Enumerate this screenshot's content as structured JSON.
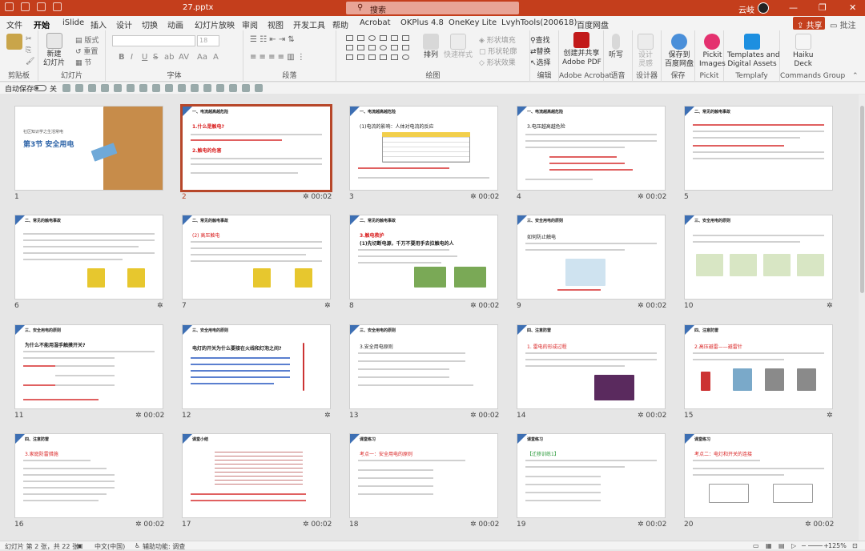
{
  "window": {
    "filename": "27.pptx",
    "search_placeholder": "搜索",
    "user": "云岐",
    "controls": [
      "—",
      "❐",
      "✕"
    ]
  },
  "tabs": [
    "文件",
    "开始",
    "iSlide",
    "插入",
    "设计",
    "切换",
    "动画",
    "幻灯片放映",
    "审阅",
    "视图",
    "开发工具",
    "帮助",
    "Acrobat",
    "OKPlus 4.8",
    "OneKey Lite",
    "LvyhTools(200618)",
    "百度网盘"
  ],
  "active_tab": "开始",
  "share_label": "共享",
  "comment_label": "批注",
  "ribbon": {
    "clipboard": {
      "label": "剪贴板"
    },
    "slides": {
      "label": "幻灯片",
      "new_slide": "新建\n幻灯片",
      "layout": "版式",
      "reset": "重置",
      "section": "节"
    },
    "font": {
      "label": "字体",
      "size": "18",
      "format_buttons": [
        "B",
        "I",
        "U",
        "S",
        "ab",
        "AV",
        "Aa",
        "A"
      ]
    },
    "paragraph": {
      "label": "段落"
    },
    "drawing": {
      "label": "绘图",
      "arrange": "排列",
      "quick_styles": "快速样式",
      "fill": "形状填充",
      "outline": "形状轮廓",
      "effects": "形状效果"
    },
    "editing": {
      "label": "编辑",
      "find": "查找",
      "replace": "替换",
      "select": "选择"
    },
    "acrobat": {
      "label": "Adobe Acrobat",
      "create": "创建并共享\nAdobe PDF"
    },
    "voice": {
      "label": "语音",
      "dictate": "听写"
    },
    "designer": {
      "label": "设计器",
      "design": "设计\n灵感"
    },
    "save": {
      "label": "保存",
      "baidu": "保存到\n百度网盘"
    },
    "pickit": {
      "label": "Pickit",
      "images": "Pickit\nImages"
    },
    "templafy": {
      "label": "Templafy",
      "assets": "Templates and\nDigital Assets"
    },
    "commands": {
      "label": "Commands Group",
      "deck": "Haiku\nDeck"
    }
  },
  "quick_access": {
    "autosave_label": "自动保存",
    "autosave_state": "关"
  },
  "slides": [
    {
      "num": "1",
      "title": "第3节 安全用电",
      "subtitle": "社区知识学之生活常电",
      "time": ""
    },
    {
      "num": "2",
      "title": "一、电流越高越危险",
      "heading1": "1.什么是触电?",
      "heading2": "2.触电的危害",
      "time": "00:02",
      "selected": true
    },
    {
      "num": "3",
      "title": "一、电流越高越危险",
      "heading1": "(1)电流的影响：人体对电流的反应",
      "time": "00:02"
    },
    {
      "num": "4",
      "title": "一、电流越高越危险",
      "heading1": "3.电压越高越危险",
      "time": "00:02"
    },
    {
      "num": "5",
      "title": "二、常见的触电事故",
      "time": ""
    },
    {
      "num": "6",
      "title": "二、常见的触电事故",
      "time": ""
    },
    {
      "num": "7",
      "title": "二、常见的触电事故",
      "heading1": "(2) 高压触电",
      "time": ""
    },
    {
      "num": "8",
      "title": "二、常见的触电事故",
      "heading1": "3.触电救护",
      "heading2": "(1)先切断电源，千万不要用手去拉触电的人",
      "time": "00:02"
    },
    {
      "num": "9",
      "title": "三、安全用电的原则",
      "heading1": "如何防止触电",
      "time": "00:02"
    },
    {
      "num": "10",
      "title": "三、安全用电的原则",
      "time": ""
    },
    {
      "num": "11",
      "title": "三、安全用电的原则",
      "heading1": "为什么不能用湿手触摸开关?",
      "time": "00:02"
    },
    {
      "num": "12",
      "title": "三、安全用电的原则",
      "heading1": "电灯的开关为什么要接在火线和灯泡之间?",
      "time": ""
    },
    {
      "num": "13",
      "title": "三、安全用电的原则",
      "heading1": "3.安全用电原则",
      "time": "00:02"
    },
    {
      "num": "14",
      "title": "四、注意防雷",
      "heading1": "1. 雷电的形成过程",
      "time": "00:02"
    },
    {
      "num": "15",
      "title": "四、注意防雷",
      "heading1": "2.高压避雷——避雷针",
      "time": ""
    },
    {
      "num": "16",
      "title": "四、注意防雷",
      "heading1": "3.家庭防雷措施",
      "time": "00:02"
    },
    {
      "num": "17",
      "title": "课堂小结",
      "time": "00:02"
    },
    {
      "num": "18",
      "title": "课堂练习",
      "heading1": "考点一：安全用电的原则",
      "time": "00:02"
    },
    {
      "num": "19",
      "title": "课堂练习",
      "heading1": "【迁移训练1】",
      "time": "00:02"
    },
    {
      "num": "20",
      "title": "课堂练习",
      "heading1": "考点二：电灯和开关的连接",
      "time": "00:02"
    }
  ],
  "status": {
    "slide_info": "幻灯片 第 2 张，共 22 张",
    "language": "中文(中国)",
    "accessibility": "辅助功能: 调查",
    "zoom": "125%"
  },
  "colors": {
    "brand": "#c43e1c",
    "slide_accent": "#3d6fb3",
    "selection": "#b7472a"
  }
}
